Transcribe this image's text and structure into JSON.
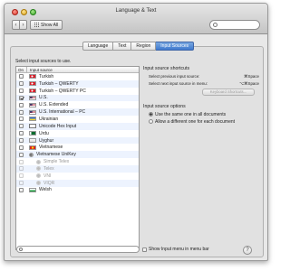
{
  "window": {
    "title": "Language & Text"
  },
  "toolbar": {
    "show_all": "Show All"
  },
  "tabs": [
    {
      "label": "Language",
      "active": false
    },
    {
      "label": "Text",
      "active": false
    },
    {
      "label": "Region",
      "active": false
    },
    {
      "label": "Input Sources",
      "active": true
    }
  ],
  "input_list": {
    "prompt": "Select input sources to use.",
    "header_on": "On",
    "header_name": "Input source",
    "items": [
      {
        "name": "Turkish",
        "checked": false,
        "flag": "turkish-flag"
      },
      {
        "name": "Turkish – QWERTY",
        "checked": false,
        "flag": "turkish-flag"
      },
      {
        "name": "Turkish – QWERTY PC",
        "checked": false,
        "flag": "turkish-flag"
      },
      {
        "name": "U.S.",
        "checked": true,
        "flag": "us-flag"
      },
      {
        "name": "U.S. Extended",
        "checked": false,
        "flag": "us-flag"
      },
      {
        "name": "U.S. International – PC",
        "checked": false,
        "flag": "us-flag"
      },
      {
        "name": "Ukrainian",
        "checked": false,
        "flag": "ukraine-flag"
      },
      {
        "name": "Unicode Hex Input",
        "checked": false,
        "flag": "unicode-icon"
      },
      {
        "name": "Urdu",
        "checked": false,
        "flag": "pakistan-flag"
      },
      {
        "name": "Uyghur",
        "checked": false,
        "flag": "uyghur-icon"
      },
      {
        "name": "Vietnamese",
        "checked": false,
        "flag": "vietnam-flag"
      },
      {
        "name": "Vietnamese UniKey",
        "checked": false,
        "flag": "unikey-icon",
        "expanded": true
      },
      {
        "name": "Simple Telex",
        "checked": false,
        "flag": "sub-icon",
        "sub": true
      },
      {
        "name": "Telex",
        "checked": false,
        "flag": "sub-icon",
        "sub": true
      },
      {
        "name": "VNI",
        "checked": false,
        "flag": "sub-icon",
        "sub": true
      },
      {
        "name": "VIQR",
        "checked": false,
        "flag": "sub-icon",
        "sub": true
      },
      {
        "name": "Welsh",
        "checked": false,
        "flag": "welsh-flag"
      }
    ]
  },
  "shortcuts": {
    "title": "Input source shortcuts",
    "previous_label": "Select previous input source:",
    "previous_key": "⌘Space",
    "next_label": "Select next input source in menu:",
    "next_key": "⌥⌘Space",
    "keyboard_button": "Keyboard Shortcuts..."
  },
  "options": {
    "title": "Input source options",
    "same": "Use the same one in all documents",
    "different": "Allow a different one for each document"
  },
  "footer": {
    "show_menu": "Show Input menu in menu bar",
    "help": "?"
  },
  "colors": {
    "tab_active": "#3f79cf",
    "row_alt": "#edf3fe"
  }
}
